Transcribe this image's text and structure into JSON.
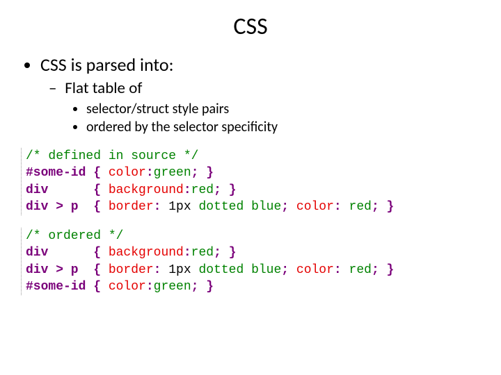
{
  "title": "CSS",
  "bullets": {
    "l1": "CSS is parsed into:",
    "l2": "Flat table of",
    "l3a": "selector/struct style pairs",
    "l3b": "ordered  by  the selector specificity"
  },
  "code1": {
    "comment": "/* defined in source */",
    "r1_sel": "#some-id ",
    "r1_ob": "{ ",
    "r1_p": "color",
    "r1_c": ":",
    "r1_v": "green",
    "r1_s": "; ",
    "r1_cb": "}",
    "r2_sel": "div      ",
    "r2_ob": "{ ",
    "r2_p": "background",
    "r2_c": ":",
    "r2_v": "red",
    "r2_s": "; ",
    "r2_cb": "}",
    "r3_sel": "div > p  ",
    "r3_ob": "{ ",
    "r3_p1": "border",
    "r3_c1": ": ",
    "r3_v1a": "1px ",
    "r3_v1b": "dotted blue",
    "r3_s1": "; ",
    "r3_p2": "color",
    "r3_c2": ": ",
    "r3_v2": "red",
    "r3_s2": "; ",
    "r3_cb": "}"
  },
  "code2": {
    "comment": "/* ordered */",
    "r1_sel": "div      ",
    "r1_ob": "{ ",
    "r1_p": "background",
    "r1_c": ":",
    "r1_v": "red",
    "r1_s": "; ",
    "r1_cb": "}",
    "r2_sel": "div > p  ",
    "r2_ob": "{ ",
    "r2_p1": "border",
    "r2_c1": ": ",
    "r2_v1a": "1px ",
    "r2_v1b": "dotted blue",
    "r2_s1": "; ",
    "r2_p2": "color",
    "r2_c2": ": ",
    "r2_v2": "red",
    "r2_s2": "; ",
    "r2_cb": "}",
    "r3_sel": "#some-id ",
    "r3_ob": "{ ",
    "r3_p": "color",
    "r3_c": ":",
    "r3_v": "green",
    "r3_s": "; ",
    "r3_cb": "}"
  }
}
